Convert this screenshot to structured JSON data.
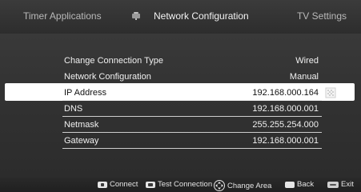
{
  "tabs": {
    "left": "Timer Applications",
    "center": "Network Configuration",
    "right": "TV Settings",
    "center_icon": "network-icon"
  },
  "settings": [
    {
      "label": "Change Connection Type",
      "value": "Wired"
    },
    {
      "label": "Network Configuration",
      "value": "Manual"
    },
    {
      "label": "IP Address",
      "value": "192.168.000.164",
      "selected": true
    },
    {
      "label": "DNS",
      "value": "192.168.000.001"
    },
    {
      "label": "Netmask",
      "value": "255.255.254.000"
    },
    {
      "label": "Gateway",
      "value": "192.168.000.001"
    }
  ],
  "help": {
    "connect": "Connect",
    "test_connection": "Test Connection",
    "change_area": "Change Area",
    "back": "Back",
    "exit": "Exit"
  },
  "colors": {
    "background": "#2f2f2f",
    "text": "#e6e6e6",
    "selection": "#ffffff",
    "separator": "#e9e9e9"
  }
}
